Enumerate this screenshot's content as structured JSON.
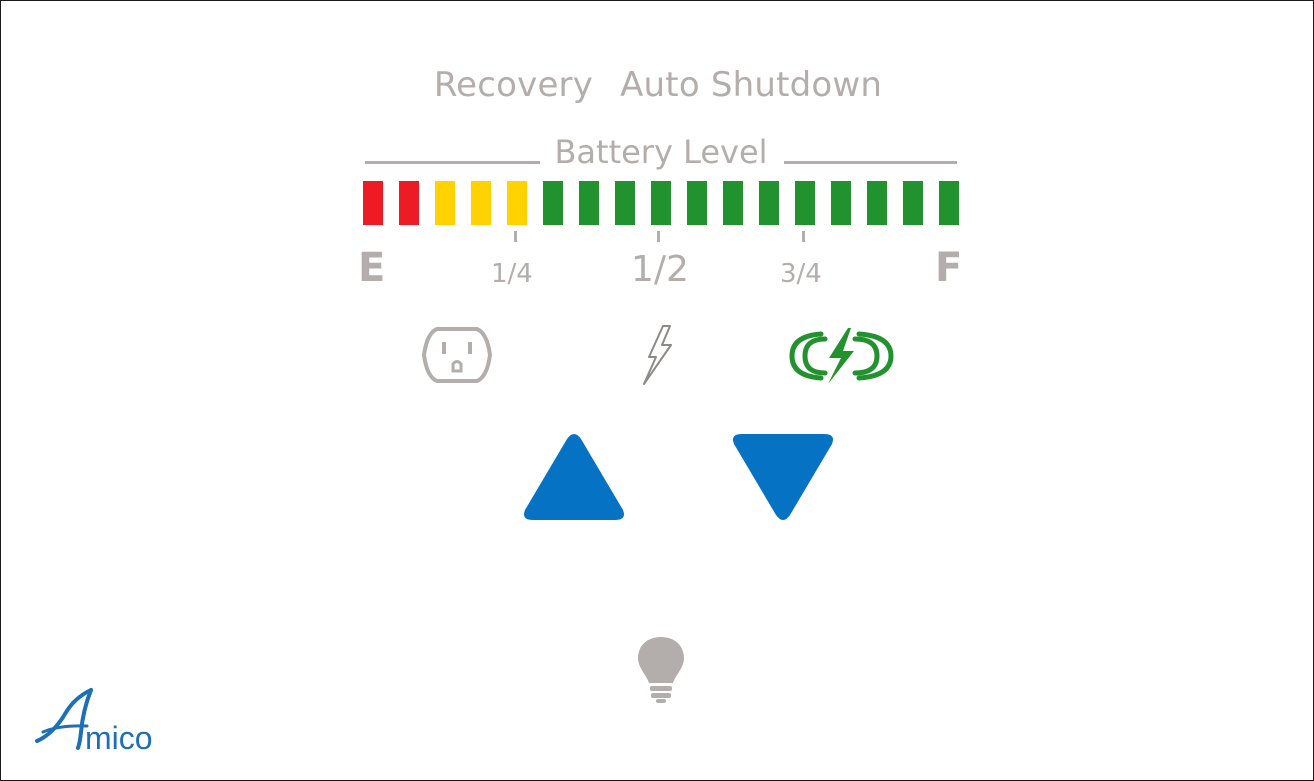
{
  "modes": {
    "recovery": "Recovery",
    "auto_shutdown": "Auto Shutdown"
  },
  "battery": {
    "title": "Battery Level",
    "empty_label": "E",
    "quarter_label": "1/4",
    "half_label": "1/2",
    "three_quarter_label": "3/4",
    "full_label": "F",
    "segment_count": 17,
    "lit_segments": 17,
    "segment_colors": [
      "#ed1c24",
      "#ed1c24",
      "#ffd200",
      "#ffd200",
      "#ffd200",
      "#22922f",
      "#22922f",
      "#22922f",
      "#22922f",
      "#22922f",
      "#22922f",
      "#22922f",
      "#22922f",
      "#22922f",
      "#22922f",
      "#22922f",
      "#22922f"
    ]
  },
  "status_icons": {
    "outlet": "outlet-icon",
    "power": "lightning-icon",
    "charging": "charging-battery-icon",
    "charging_color": "#22922f",
    "inactive_color": "#b3aeab"
  },
  "controls": {
    "up": "up-arrow-icon",
    "down": "down-arrow-icon",
    "accent": "#0572c4"
  },
  "light": {
    "icon": "lightbulb-icon"
  },
  "brand": {
    "logo_letter": "A",
    "logo_text": "mico",
    "color": "#1d6fb8"
  }
}
